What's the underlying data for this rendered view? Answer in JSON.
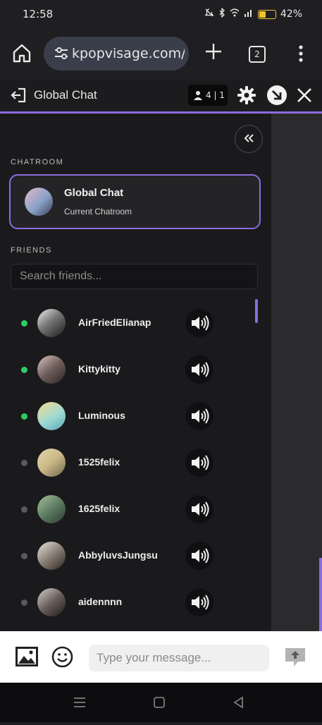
{
  "status_bar": {
    "time": "12:58",
    "battery_percent": "42%",
    "battery_level": 0.42
  },
  "browser": {
    "url": "kpopvisage.com/",
    "tab_count": "2"
  },
  "chat_header": {
    "title": "Global Chat",
    "user_count": "4 | 1"
  },
  "sidebar": {
    "chatroom_label": "CHATROOM",
    "chatroom": {
      "name": "Global Chat",
      "subtitle": "Current Chatroom"
    },
    "friends_label": "FRIENDS",
    "search_placeholder": "Search friends...",
    "friends": [
      {
        "name": "AirFriedElianap",
        "online": true
      },
      {
        "name": "Kittykitty",
        "online": true
      },
      {
        "name": "Luminous",
        "online": true
      },
      {
        "name": "1525felix",
        "online": false
      },
      {
        "name": "1625felix",
        "online": false
      },
      {
        "name": "AbbyluvsJungsu",
        "online": false
      },
      {
        "name": "aidennnn",
        "online": false
      }
    ]
  },
  "composer": {
    "placeholder": "Type your message..."
  },
  "colors": {
    "accent": "#8a6ce0",
    "online": "#2fcc66",
    "offline": "#5a5a5e"
  }
}
